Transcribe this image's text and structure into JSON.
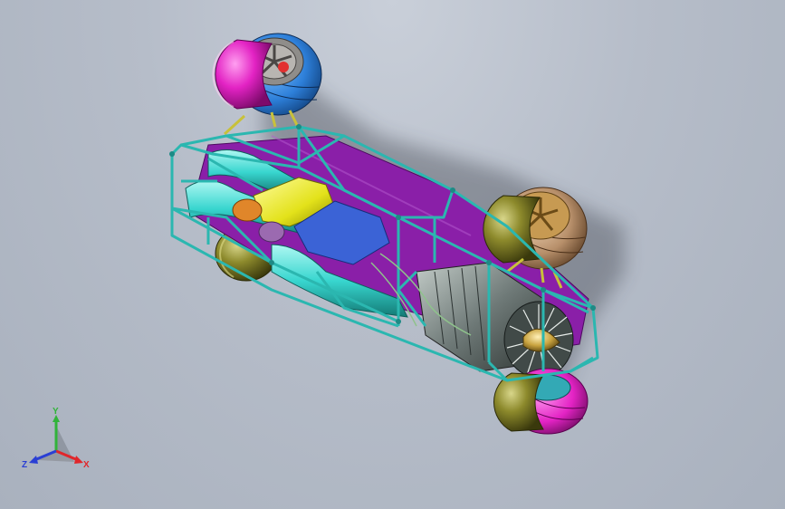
{
  "viewport": {
    "colors": {
      "frame_tube": "#2bb7b0",
      "floor_panel": "#8a1fa8",
      "duct": "#38d6cf",
      "tire_blue": "#2d7fd9",
      "tire_magenta": "#e323c4",
      "tire_brown": "#b78f6a",
      "fairing_olive": "#6b6a1c",
      "engine_grey": "#6f7a78",
      "fuel_tank": "#e3e21a",
      "exhaust_orange": "#e0862a",
      "nose_cone": "#c9a33f"
    }
  },
  "triad": {
    "x_label": "X",
    "y_label": "Y",
    "z_label": "Z",
    "x_color": "#e0262b",
    "y_color": "#31b33a",
    "z_color": "#2a3fd4"
  }
}
